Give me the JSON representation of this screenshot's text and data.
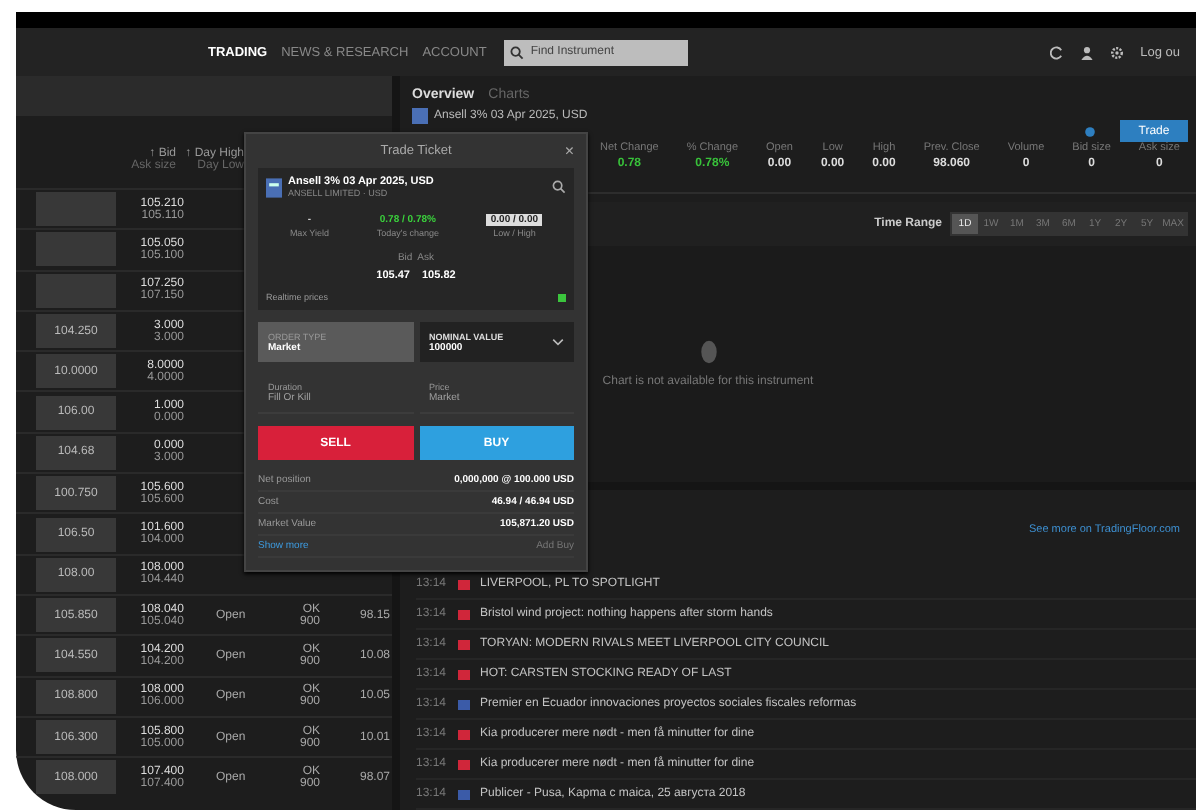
{
  "nav": {
    "tabs": [
      {
        "label": "TRADING",
        "selected": true
      },
      {
        "label": "NEWS & RESEARCH",
        "selected": false
      },
      {
        "label": "ACCOUNT",
        "selected": false
      }
    ],
    "search": {
      "placeholder": "Find Instrument"
    },
    "logout": "Log ou"
  },
  "watchlist": {
    "columns": [
      {
        "label": "↑ Bid",
        "sub": "Ask size"
      },
      {
        "label": "↑ Day High",
        "sub": "Day Low"
      }
    ],
    "rows": [
      {
        "c2a": "105.210",
        "c2b": "105.110"
      },
      {
        "c2a": "105.050",
        "c2b": "105.100"
      },
      {
        "c2a": "107.250",
        "c2b": "107.150"
      },
      {
        "c1": "104.250",
        "c2a": "3.000",
        "c2b": "3.000"
      },
      {
        "c1": "10.0000",
        "c2a": "8.0000",
        "c2b": "4.0000"
      },
      {
        "c1": "106.00",
        "c2a": "1.000",
        "c2b": "0.000"
      },
      {
        "c1": "104.68",
        "c2a": "0.000",
        "c2b": "3.000"
      },
      {
        "c1": "100.750",
        "c2a": "105.600",
        "c2b": "105.600"
      },
      {
        "c1": "106.50",
        "c2a": "101.600",
        "c2b": "104.000"
      },
      {
        "c1": "108.00",
        "c2a": "108.000",
        "c2b": "104.440"
      },
      {
        "c1": "105.850",
        "c2a": "108.040",
        "c2b": "105.040",
        "status": "Open",
        "c4a": "OK",
        "c4b": "900",
        "c5": "98.15"
      },
      {
        "c1": "104.550",
        "c2a": "104.200",
        "c2b": "104.200",
        "status": "Open",
        "c4a": "OK",
        "c4b": "900",
        "c5": "10.08"
      },
      {
        "c1": "108.800",
        "c2a": "108.000",
        "c2b": "106.000",
        "status": "Open",
        "c4a": "OK",
        "c4b": "900",
        "c5": "10.05"
      },
      {
        "c1": "106.300",
        "c2a": "105.800",
        "c2b": "105.000",
        "status": "Open",
        "c4a": "OK",
        "c4b": "900",
        "c5": "10.01"
      },
      {
        "c1": "108.000",
        "c2a": "107.400",
        "c2b": "107.400",
        "status": "Open",
        "c4a": "OK",
        "c4b": "900",
        "c5": "98.07"
      }
    ]
  },
  "overview": {
    "tabs": [
      {
        "label": "Overview",
        "selected": true
      },
      {
        "label": "Charts",
        "selected": false
      }
    ],
    "instrument": "Ansell 3% 03 Apr 2025, USD",
    "trade_button": "Trade",
    "stats": [
      {
        "label": "Net Change",
        "value": "0.78",
        "positive": true
      },
      {
        "label": "% Change",
        "value": "0.78%",
        "positive": true
      },
      {
        "label": "Open",
        "value": "0.00",
        "positive": false
      },
      {
        "label": "Low",
        "value": "0.00",
        "positive": false
      },
      {
        "label": "High",
        "value": "0.00",
        "positive": false
      },
      {
        "label": "Prev. Close",
        "value": "98.060",
        "positive": false
      },
      {
        "label": "Volume",
        "value": "0",
        "positive": false
      },
      {
        "label": "Bid size",
        "value": "0",
        "positive": false
      },
      {
        "label": "Ask size",
        "value": "0",
        "positive": false
      }
    ],
    "time_range": {
      "label": "Time Range",
      "options": [
        {
          "label": "1D",
          "selected": true
        },
        {
          "label": "1W",
          "selected": false
        },
        {
          "label": "1M",
          "selected": false
        },
        {
          "label": "3M",
          "selected": false
        },
        {
          "label": "6M",
          "selected": false
        },
        {
          "label": "1Y",
          "selected": false
        },
        {
          "label": "2Y",
          "selected": false
        },
        {
          "label": "5Y",
          "selected": false
        },
        {
          "label": "MAX",
          "selected": false
        }
      ]
    },
    "chart_message": "Chart is not available for this instrument"
  },
  "news": {
    "link": "See more on TradingFloor.com",
    "items": [
      {
        "time": "13:14",
        "color": "#d0263a",
        "text": "LIVERPOOL, PL TO SPOTLIGHT"
      },
      {
        "time": "13:14",
        "color": "#d0263a",
        "text": "Bristol wind project: nothing happens after storm hands"
      },
      {
        "time": "13:14",
        "color": "#d0263a",
        "text": "TORYAN: MODERN RIVALS MEET LIVERPOOL CITY COUNCIL"
      },
      {
        "time": "13:14",
        "color": "#d0263a",
        "text": "HOT: CARSTEN STOCKING READY OF LAST"
      },
      {
        "time": "13:14",
        "color": "#3b5ba8",
        "text": "Premier en Ecuador innovaciones proyectos sociales fiscales reformas"
      },
      {
        "time": "13:14",
        "color": "#d0263a",
        "text": "Kia producerer mere nødt - men få minutter for dine"
      },
      {
        "time": "13:14",
        "color": "#d0263a",
        "text": "Kia producerer mere nødt - men få minutter for dine"
      },
      {
        "time": "13:14",
        "color": "#3b5ba8",
        "text": "Publicer - Pusa, Kapma c maica, 25 августа 2018"
      }
    ]
  },
  "ticket": {
    "title": "Trade Ticket",
    "close": "×",
    "instrument": "Ansell 3% 03 Apr 2025, USD",
    "subtitle": "ANSELL LIMITED · USD",
    "stats": [
      {
        "value": "-",
        "label": "Max Yield",
        "kind": "plain"
      },
      {
        "value": "0.78 / 0.78%",
        "label": "Today's change",
        "kind": "positive"
      },
      {
        "value": "0.00 / 0.00",
        "label": "Low / High",
        "kind": "boxed"
      }
    ],
    "bid_ask_label": "Bid  Ask",
    "bid": "105.47",
    "ask": "105.82",
    "realtime": "Realtime prices",
    "live": true,
    "order_type": {
      "label": "ORDER TYPE",
      "value": "Market"
    },
    "nominal": {
      "label": "NOMINAL VALUE",
      "value": "100000"
    },
    "duration": {
      "label": "Duration",
      "value": "Fill Or Kill"
    },
    "price": {
      "label": "Price",
      "value": "Market"
    },
    "sell": "SELL",
    "buy": "BUY",
    "summary": [
      {
        "label": "Net position",
        "value": "0,000,000 @ 100.000 USD"
      },
      {
        "label": "Cost",
        "value": "46.94 / 46.94 USD"
      },
      {
        "label": "Market Value",
        "value": "105,871.20 USD"
      }
    ],
    "show_more": "Show more",
    "add_rep": "Add Buy"
  }
}
